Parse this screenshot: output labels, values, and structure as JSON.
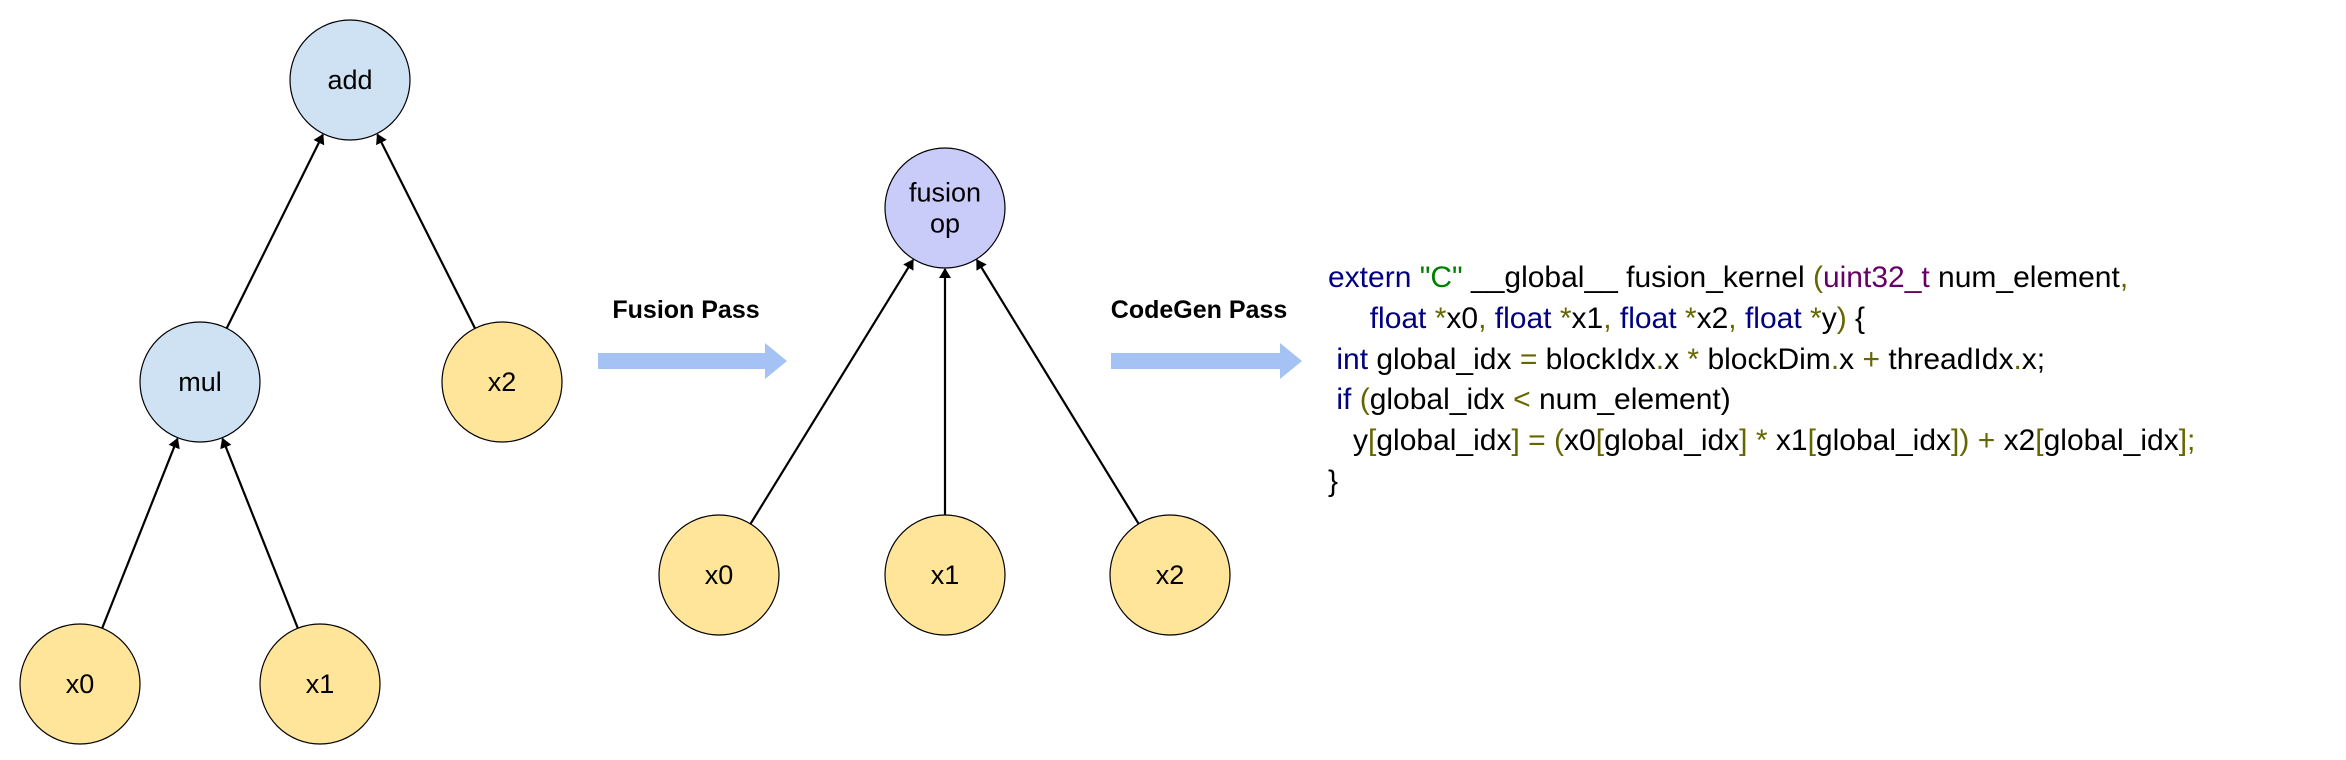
{
  "colors": {
    "op_node_fill": "#cfe2f3",
    "input_node_fill": "#ffe599",
    "fused_node_fill": "#c9cbf9",
    "node_stroke": "#000000",
    "pass_arrow": "#a4c2f4",
    "keyword": "#000080",
    "string": "#008000",
    "type": "#660066",
    "punctuation": "#666600"
  },
  "graph_before": {
    "nodes": [
      {
        "id": "add",
        "label": "add",
        "kind": "op"
      },
      {
        "id": "mul",
        "label": "mul",
        "kind": "op"
      },
      {
        "id": "x2",
        "label": "x2",
        "kind": "input"
      },
      {
        "id": "x0",
        "label": "x0",
        "kind": "input"
      },
      {
        "id": "x1",
        "label": "x1",
        "kind": "input"
      }
    ],
    "edges": [
      {
        "from": "mul",
        "to": "add"
      },
      {
        "from": "x2",
        "to": "add"
      },
      {
        "from": "x0",
        "to": "mul"
      },
      {
        "from": "x1",
        "to": "mul"
      }
    ]
  },
  "graph_after": {
    "nodes": [
      {
        "id": "fusion",
        "label_lines": [
          "fusion",
          "op"
        ],
        "kind": "fused"
      },
      {
        "id": "x0",
        "label": "x0",
        "kind": "input"
      },
      {
        "id": "x1",
        "label": "x1",
        "kind": "input"
      },
      {
        "id": "x2",
        "label": "x2",
        "kind": "input"
      }
    ],
    "edges": [
      {
        "from": "x0",
        "to": "fusion"
      },
      {
        "from": "x1",
        "to": "fusion"
      },
      {
        "from": "x2",
        "to": "fusion"
      }
    ]
  },
  "passes": {
    "fusion": {
      "label": "Fusion Pass"
    },
    "codegen": {
      "label": "CodeGen Pass"
    }
  },
  "code": {
    "lines": [
      [
        [
          "kw",
          "extern "
        ],
        [
          "str",
          "\"C\""
        ],
        [
          "id",
          " __global__ fusion_kernel "
        ],
        [
          "pn",
          "("
        ],
        [
          "ty",
          "uint32_t"
        ],
        [
          "id",
          " num_element"
        ],
        [
          "pn",
          ","
        ]
      ],
      [
        [
          "id",
          "     "
        ],
        [
          "kw",
          "float "
        ],
        [
          "pn",
          "*"
        ],
        [
          "id",
          "x0"
        ],
        [
          "pn",
          ", "
        ],
        [
          "kw",
          "float "
        ],
        [
          "pn",
          "*"
        ],
        [
          "id",
          "x1"
        ],
        [
          "pn",
          ", "
        ],
        [
          "kw",
          "float "
        ],
        [
          "pn",
          "*"
        ],
        [
          "id",
          "x2"
        ],
        [
          "pn",
          ", "
        ],
        [
          "kw",
          "float "
        ],
        [
          "pn",
          "*"
        ],
        [
          "id",
          "y"
        ],
        [
          "pn",
          ")"
        ],
        [
          "id",
          " {"
        ]
      ],
      [
        [
          "id",
          " "
        ],
        [
          "kw",
          "int"
        ],
        [
          "id",
          " global_idx "
        ],
        [
          "pn",
          "="
        ],
        [
          "id",
          " blockIdx"
        ],
        [
          "pn",
          "."
        ],
        [
          "id",
          "x "
        ],
        [
          "pn",
          "*"
        ],
        [
          "id",
          " blockDim"
        ],
        [
          "pn",
          "."
        ],
        [
          "id",
          "x "
        ],
        [
          "pn",
          "+"
        ],
        [
          "id",
          " threadIdx"
        ],
        [
          "pn",
          "."
        ],
        [
          "id",
          "x;"
        ]
      ],
      [
        [
          "id",
          " "
        ],
        [
          "kw",
          "if"
        ],
        [
          "id",
          " "
        ],
        [
          "pn",
          "("
        ],
        [
          "id",
          "global_idx "
        ],
        [
          "pn",
          "<"
        ],
        [
          "id",
          " num_element)"
        ]
      ],
      [
        [
          "id",
          "   y"
        ],
        [
          "pn",
          "["
        ],
        [
          "id",
          "global_idx"
        ],
        [
          "pn",
          "]"
        ],
        [
          "id",
          " "
        ],
        [
          "pn",
          "="
        ],
        [
          "id",
          " "
        ],
        [
          "pn",
          "("
        ],
        [
          "id",
          "x0"
        ],
        [
          "pn",
          "["
        ],
        [
          "id",
          "global_idx"
        ],
        [
          "pn",
          "]"
        ],
        [
          "id",
          " "
        ],
        [
          "pn",
          "*"
        ],
        [
          "id",
          " x1"
        ],
        [
          "pn",
          "["
        ],
        [
          "id",
          "global_idx"
        ],
        [
          "pn",
          "])"
        ],
        [
          "id",
          " "
        ],
        [
          "pn",
          "+"
        ],
        [
          "id",
          " x2"
        ],
        [
          "pn",
          "["
        ],
        [
          "id",
          "global_idx"
        ],
        [
          "pn",
          "];"
        ]
      ],
      [
        [
          "id",
          "}"
        ]
      ]
    ]
  }
}
